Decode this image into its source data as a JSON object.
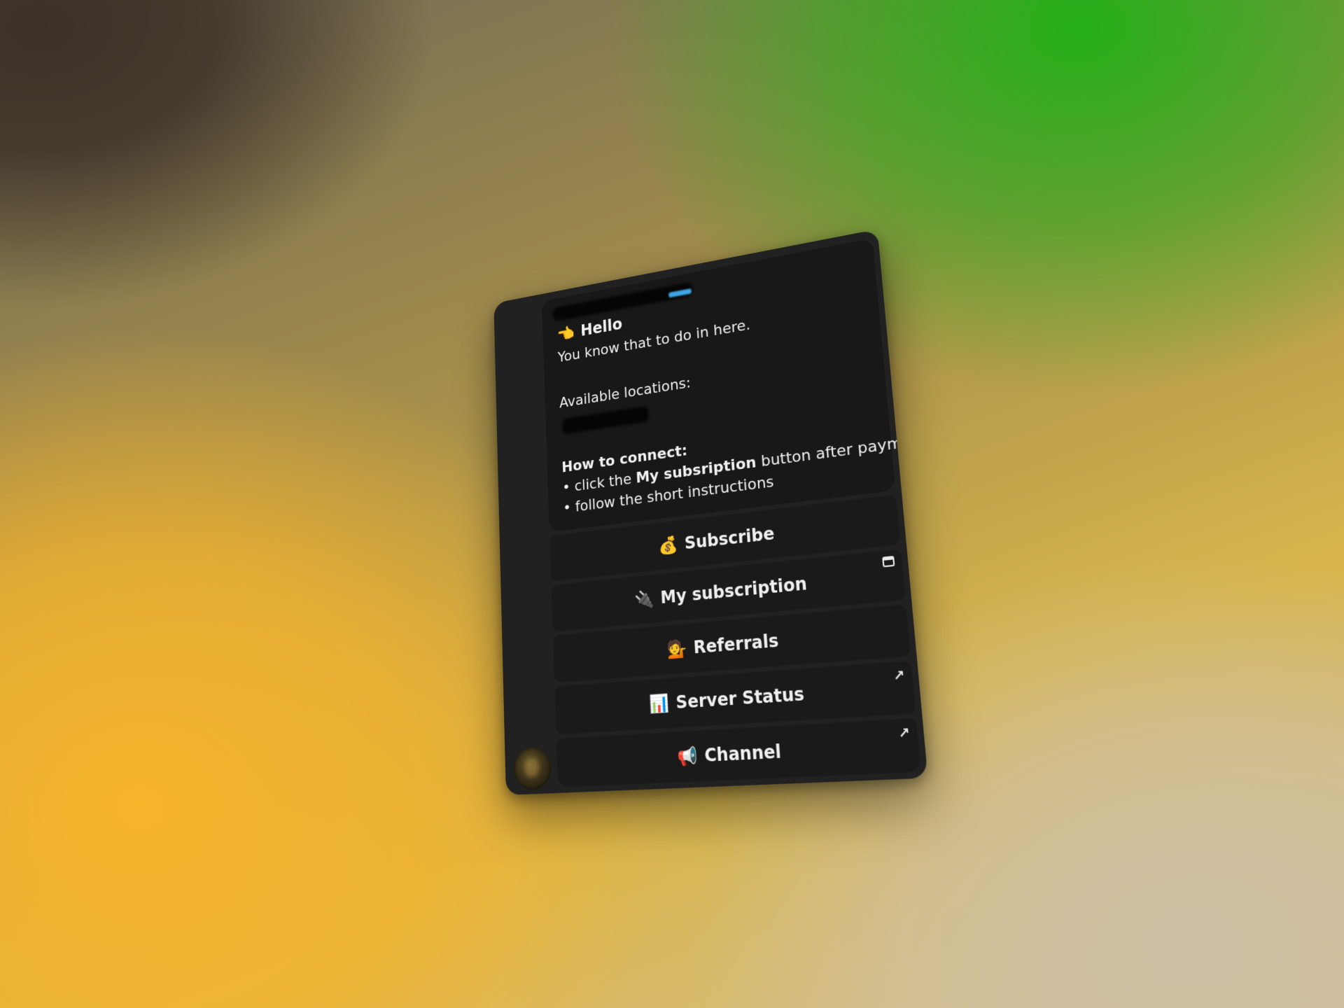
{
  "message": {
    "greeting_emoji": "👈",
    "greeting": "Hello",
    "intro": "You know that to do in here.",
    "locations_label": "Available locations:",
    "how_to_title": "How to connect:",
    "bullet1_prefix": "• click the ",
    "bullet1_bold": "My subsription",
    "bullet1_suffix": " button after payment",
    "bullet2": "• follow the short instructions"
  },
  "keyboard": {
    "buttons": [
      {
        "label": "Subscribe",
        "icon": "money-bag-icon",
        "glyph": "💰"
      },
      {
        "label": "My subscription",
        "icon": "plug-icon",
        "glyph": "🔌",
        "corner": "web-app-icon"
      },
      {
        "label": "Referrals",
        "icon": "person-icon",
        "glyph": "💁"
      },
      {
        "label": "Server Status",
        "icon": "bar-chart-icon",
        "glyph": "📊",
        "corner": "external-link-arrow-icon",
        "corner_glyph": "↗"
      },
      {
        "label": "Channel",
        "icon": "megaphone-icon",
        "glyph": "📢",
        "corner": "external-link-arrow-icon",
        "corner_glyph": "↗"
      }
    ]
  },
  "colors": {
    "panel": "#212121",
    "bubble": "#181818",
    "button": "#1a1a1a",
    "link_accent": "#3ea6e6"
  }
}
